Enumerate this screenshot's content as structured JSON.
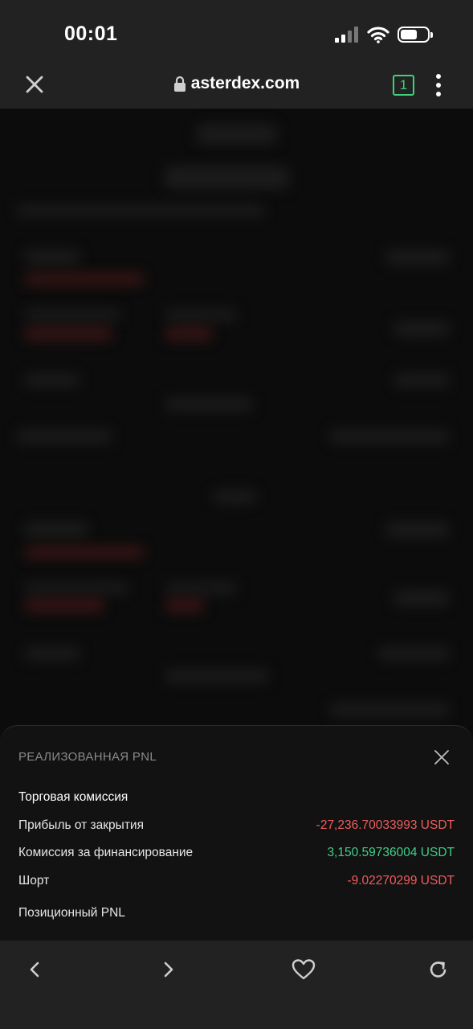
{
  "status_bar": {
    "time": "00:01",
    "icons": [
      "cellular-signal-icon",
      "wifi-icon",
      "battery-icon"
    ]
  },
  "browser": {
    "url": "asterdex.com",
    "tab_count": "1",
    "icons": [
      "close-icon",
      "lock-icon",
      "tabs-icon",
      "more-vertical-icon"
    ],
    "accent_color": "#3fd07c"
  },
  "sheet": {
    "title": "РЕАЛИЗОВАННАЯ PNL",
    "rows": [
      {
        "label": "Торговая комиссия",
        "value": ""
      },
      {
        "label": "Прибыль от закрытия",
        "value": "-27,236.70033993 USDT"
      },
      {
        "label": "Комиссия за финансирование",
        "value": "3,150.59736004 USDT"
      },
      {
        "label": "Шорт",
        "value": "-9.02270299 USDT"
      },
      {
        "label": "Позиционный PNL",
        "value": ""
      }
    ],
    "colors": {
      "negative": "#ee5d5d",
      "positive": "#3fcf8a"
    }
  },
  "bottom_nav": {
    "icons": [
      "back-icon",
      "forward-icon",
      "favorite-heart-icon",
      "reload-icon"
    ]
  }
}
